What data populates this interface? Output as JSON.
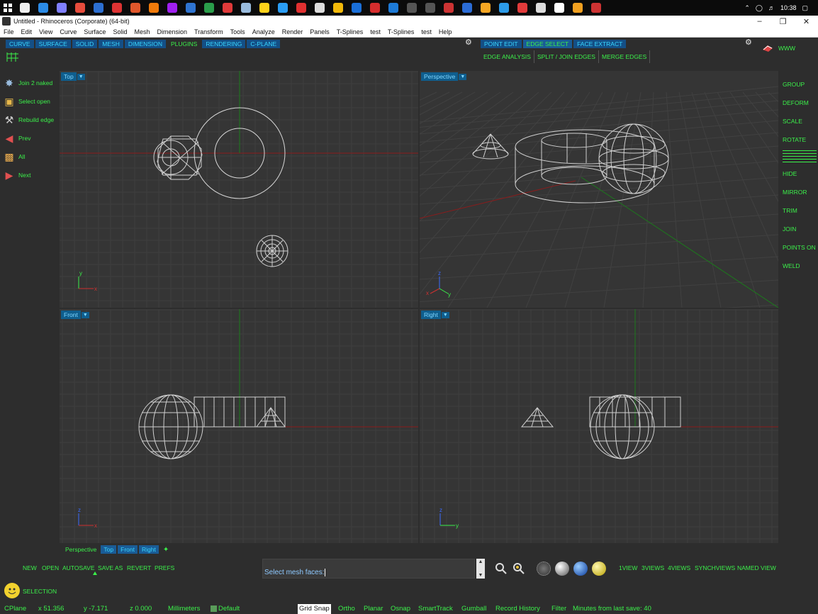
{
  "taskbar": {
    "clock": "10:38"
  },
  "window": {
    "title": "Untitled - Rhinoceros (Corporate) (64-bit)"
  },
  "menus": [
    "File",
    "Edit",
    "View",
    "Curve",
    "Surface",
    "Solid",
    "Mesh",
    "Dimension",
    "Transform",
    "Tools",
    "Analyze",
    "Render",
    "Panels",
    "T-Splines",
    "test",
    "T-Splines",
    "test",
    "Help"
  ],
  "toolbar": {
    "tabs": [
      "CURVE",
      "SURFACE",
      "SOLID",
      "MESH",
      "DIMENSION",
      "PLUGINS",
      "RENDERING",
      "C-PLANE"
    ],
    "edit_tabs": [
      "POINT EDIT",
      "EDGE SELECT",
      "FACE EXTRACT"
    ],
    "edge_buttons": [
      "EDGE ANALYSIS",
      "SPLIT / JOIN EDGES",
      "MERGE EDGES"
    ],
    "www_label": "WWW"
  },
  "left_panel": {
    "items": [
      {
        "label": "Join 2 naked",
        "icon": "join-naked-icon"
      },
      {
        "label": "Select open",
        "icon": "select-open-icon"
      },
      {
        "label": "Rebuild edge",
        "icon": "rebuild-edge-icon"
      },
      {
        "label": "Prev",
        "icon": "prev-icon"
      },
      {
        "label": "All",
        "icon": "all-icon"
      },
      {
        "label": "Next",
        "icon": "next-icon"
      }
    ]
  },
  "right_panel": {
    "items": [
      "GROUP",
      "DEFORM",
      "SCALE",
      "ROTATE",
      "HIDE",
      "MIRROR",
      "TRIM",
      "JOIN",
      "POINTS ON",
      "WELD"
    ]
  },
  "viewports": {
    "top": {
      "name": "Top"
    },
    "perspective": {
      "name": "Perspective"
    },
    "front": {
      "name": "Front"
    },
    "right": {
      "name": "Right"
    }
  },
  "viewport_tabs": [
    "Perspective",
    "Top",
    "Front",
    "Right"
  ],
  "bottom": {
    "file_buttons": [
      "NEW",
      "OPEN",
      "AUTOSAVE",
      "SAVE AS",
      "REVERT",
      "PREFS"
    ],
    "selection_label": "SELECTION",
    "command_prompt": "Select mesh faces:",
    "view_buttons": [
      "1VIEW",
      "3VIEWS",
      "4VIEWS",
      "SYNCHVIEWS",
      "NAMED VIEW"
    ]
  },
  "status": {
    "cplane": "CPlane",
    "x": "x 51.356",
    "y": "y -7.171",
    "z": "z 0.000",
    "units": "Millimeters",
    "layer": "Default",
    "grid_snap": "Grid Snap",
    "ortho": "Ortho",
    "planar": "Planar",
    "osnap": "Osnap",
    "smarttrack": "SmartTrack",
    "gumball": "Gumball",
    "record_history": "Record History",
    "filter": "Filter",
    "last_save": "Minutes from last save: 40"
  },
  "colors": {
    "accent_green": "#3bf04a",
    "accent_cyan": "#38d6ff",
    "tab_blue": "#144f86",
    "viewport_bg": "#353535",
    "x_axis": "#8a1c1c",
    "y_axis": "#1c7a1c"
  }
}
